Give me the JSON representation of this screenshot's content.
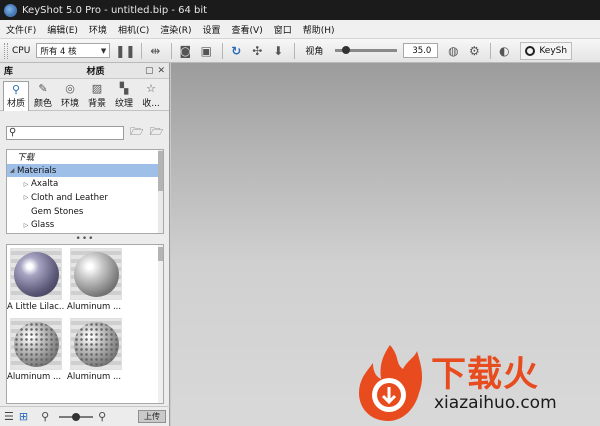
{
  "window": {
    "title": "KeyShot 5.0 Pro - untitled.bip - 64 bit"
  },
  "menu": [
    "文件(F)",
    "编辑(E)",
    "环境",
    "相机(C)",
    "渲染(R)",
    "设置",
    "查看(V)",
    "窗口",
    "帮助(H)"
  ],
  "toolbar": {
    "cpu_label": "CPU",
    "cpu_value": "所有 4 核",
    "fov_label": "视角",
    "fov_value": "35.0",
    "fov_fraction": 0.12,
    "keyshot_button": "KeySh"
  },
  "panel": {
    "library_label": "库",
    "materials_label": "材质",
    "tabs": [
      {
        "label": "材质",
        "icon": "search-icon"
      },
      {
        "label": "颜色",
        "icon": "palette-icon"
      },
      {
        "label": "环境",
        "icon": "globe-icon"
      },
      {
        "label": "背景",
        "icon": "image-icon"
      },
      {
        "label": "纹理",
        "icon": "checker-icon"
      },
      {
        "label": "收...",
        "icon": "star-icon"
      }
    ],
    "search_placeholder": "",
    "tree": [
      {
        "label": "下载",
        "level": 0,
        "italic": true
      },
      {
        "label": "Materials",
        "level": 0,
        "selected": true,
        "expanded": true
      },
      {
        "label": "Axalta",
        "level": 1
      },
      {
        "label": "Cloth and Leather",
        "level": 1
      },
      {
        "label": "Gem Stones",
        "level": 1
      },
      {
        "label": "Glass",
        "level": 1
      }
    ],
    "thumbnails": [
      {
        "label": "A Little Lilac...",
        "style": "lilac"
      },
      {
        "label": "Aluminum ...",
        "style": "alum"
      },
      {
        "label": "Aluminum ...",
        "style": "perf"
      },
      {
        "label": "Aluminum ...",
        "style": "perf"
      }
    ],
    "upload_label": "上传"
  },
  "watermark": {
    "cn": "下载火",
    "en": "xiazaihuo.com"
  },
  "colors": {
    "accent": "#2a6bb8",
    "watermark_red": "#e84c1e"
  }
}
